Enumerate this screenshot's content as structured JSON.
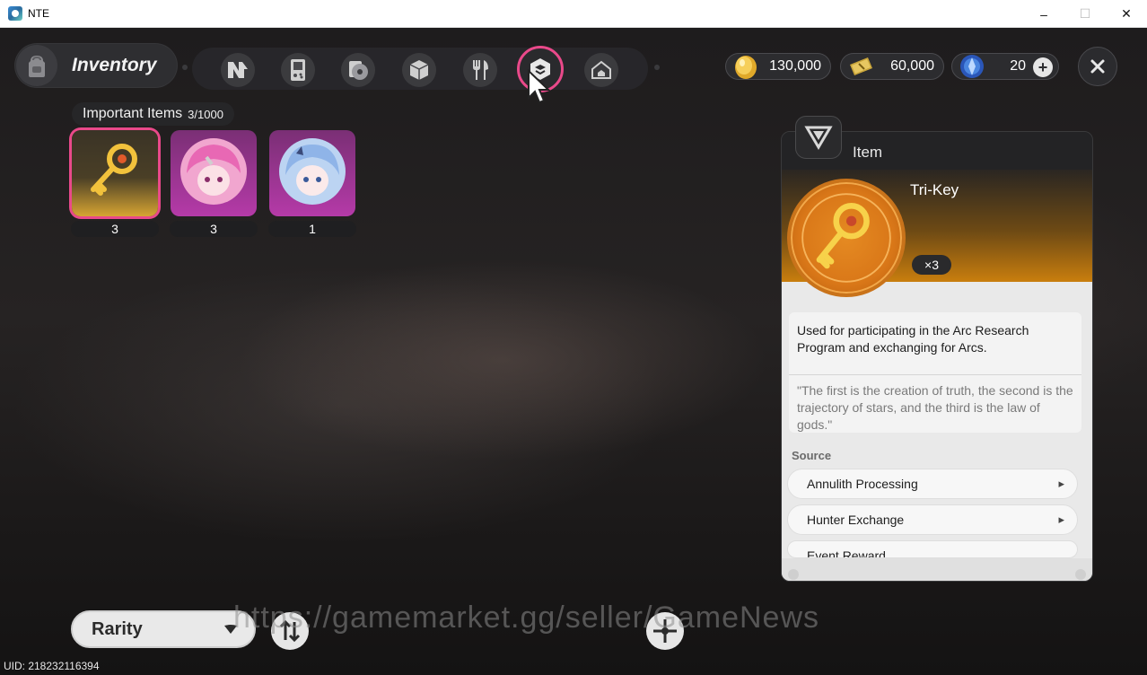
{
  "window": {
    "title": "NTE",
    "minimize": "–",
    "maximize": "☐",
    "close": "✕"
  },
  "header": {
    "title": "Inventory"
  },
  "tabs": [
    {
      "icon": "n-logo-icon"
    },
    {
      "icon": "handheld-device-icon"
    },
    {
      "icon": "disc-card-icon"
    },
    {
      "icon": "cube-icon"
    },
    {
      "icon": "fork-knife-icon"
    },
    {
      "icon": "key-item-icon",
      "active": true
    },
    {
      "icon": "house-icon"
    }
  ],
  "currencies": [
    {
      "icon": "gold-coin-icon",
      "value": "130,000"
    },
    {
      "icon": "ticket-icon",
      "value": "60,000"
    },
    {
      "icon": "crystal-icon",
      "value": "20",
      "plus": "+"
    }
  ],
  "section": {
    "label": "Important Items",
    "count": "3/1000"
  },
  "items": [
    {
      "icon": "golden-key-icon",
      "count": "3",
      "rarity": "gold",
      "selected": true
    },
    {
      "icon": "pink-hair-character-icon",
      "count": "3",
      "rarity": "pink"
    },
    {
      "icon": "blue-hair-character-icon",
      "count": "1",
      "rarity": "pink"
    }
  ],
  "detail": {
    "type": "Item",
    "name": "Tri-Key",
    "quantity": "×3",
    "description": "Used for participating in the Arc Research Program and exchanging for Arcs.",
    "quote": "\"The first is the creation of truth, the second is the trajectory of stars, and the third is the law of gods.\"",
    "source_label": "Source",
    "sources": [
      "Annulith Processing",
      "Hunter Exchange",
      "Event Reward"
    ]
  },
  "controls": {
    "sort_label": "Rarity"
  },
  "watermark": "https://gamemarket.gg/seller/GameNews",
  "uid": "UID: 218232116394",
  "colors": {
    "accent": "#e9498a",
    "gold": "#d7a532",
    "pink": "#b53aa8",
    "orange": "#c97e0e"
  }
}
